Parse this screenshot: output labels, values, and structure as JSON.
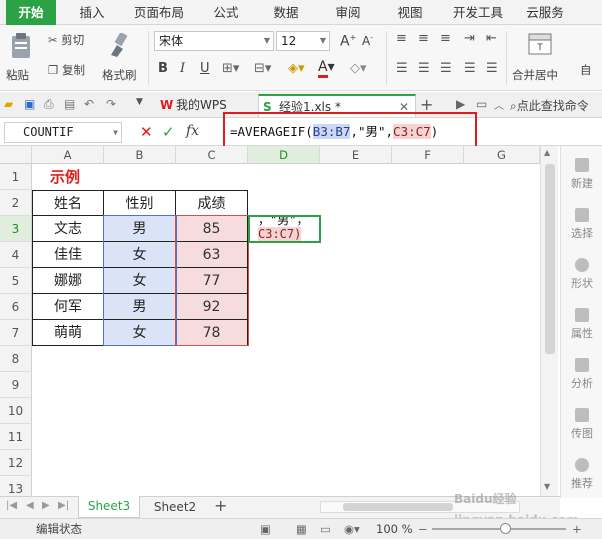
{
  "menu": {
    "items": [
      "开始",
      "插入",
      "页面布局",
      "公式",
      "数据",
      "审阅",
      "视图",
      "开发工具",
      "云服务"
    ]
  },
  "ribbon": {
    "paste_label": "粘贴",
    "cut_label": "剪切",
    "copy_label": "复制",
    "format_painter_label": "格式刷",
    "font_name": "宋体",
    "font_size": "12",
    "merge_center_label": "合并居中",
    "auto_label": "自"
  },
  "doc_tabs": {
    "tab1": "我的WPS",
    "tab2": "经验1.xls *",
    "search_label": "点此查找命令"
  },
  "formula_bar": {
    "name_box": "COUNTIF",
    "fx_label": "fx",
    "f_prefix": "=AVERAGEIF(",
    "f_range1": "B3:B7",
    "f_mid": ",\"男\",",
    "f_range2": "C3:C7",
    "f_suffix": ")"
  },
  "grid": {
    "columns": [
      "A",
      "B",
      "C",
      "D",
      "E",
      "F",
      "G"
    ],
    "rows": [
      "1",
      "2",
      "3",
      "4",
      "5",
      "6",
      "7",
      "8",
      "9",
      "10",
      "11",
      "12",
      "13"
    ],
    "title_cell": "示例",
    "headers": [
      "姓名",
      "性别",
      "成绩"
    ],
    "data": [
      [
        "文志",
        "男",
        "85"
      ],
      [
        "佳佳",
        "女",
        "63"
      ],
      [
        "娜娜",
        "女",
        "77"
      ],
      [
        "何军",
        "男",
        "92"
      ],
      [
        "萌萌",
        "女",
        "78"
      ]
    ],
    "editing_line1": "，\"男\"，",
    "editing_line2": "C3:C7)"
  },
  "right_panel": [
    "新建",
    "选择",
    "形状",
    "属性",
    "分析",
    "传图",
    "推荐"
  ],
  "sheets": {
    "tabs": [
      "Sheet3",
      "Sheet2"
    ],
    "add": "+"
  },
  "status": {
    "mode": "编辑状态",
    "zoom": "100 %"
  },
  "watermark": "Baidu经验 jingyan.baidu.com",
  "colors": {
    "accent": "#2ba245",
    "title_red": "#e01b1b",
    "range_blue": "#dbe3f7",
    "range_red": "#f6dcdc"
  }
}
